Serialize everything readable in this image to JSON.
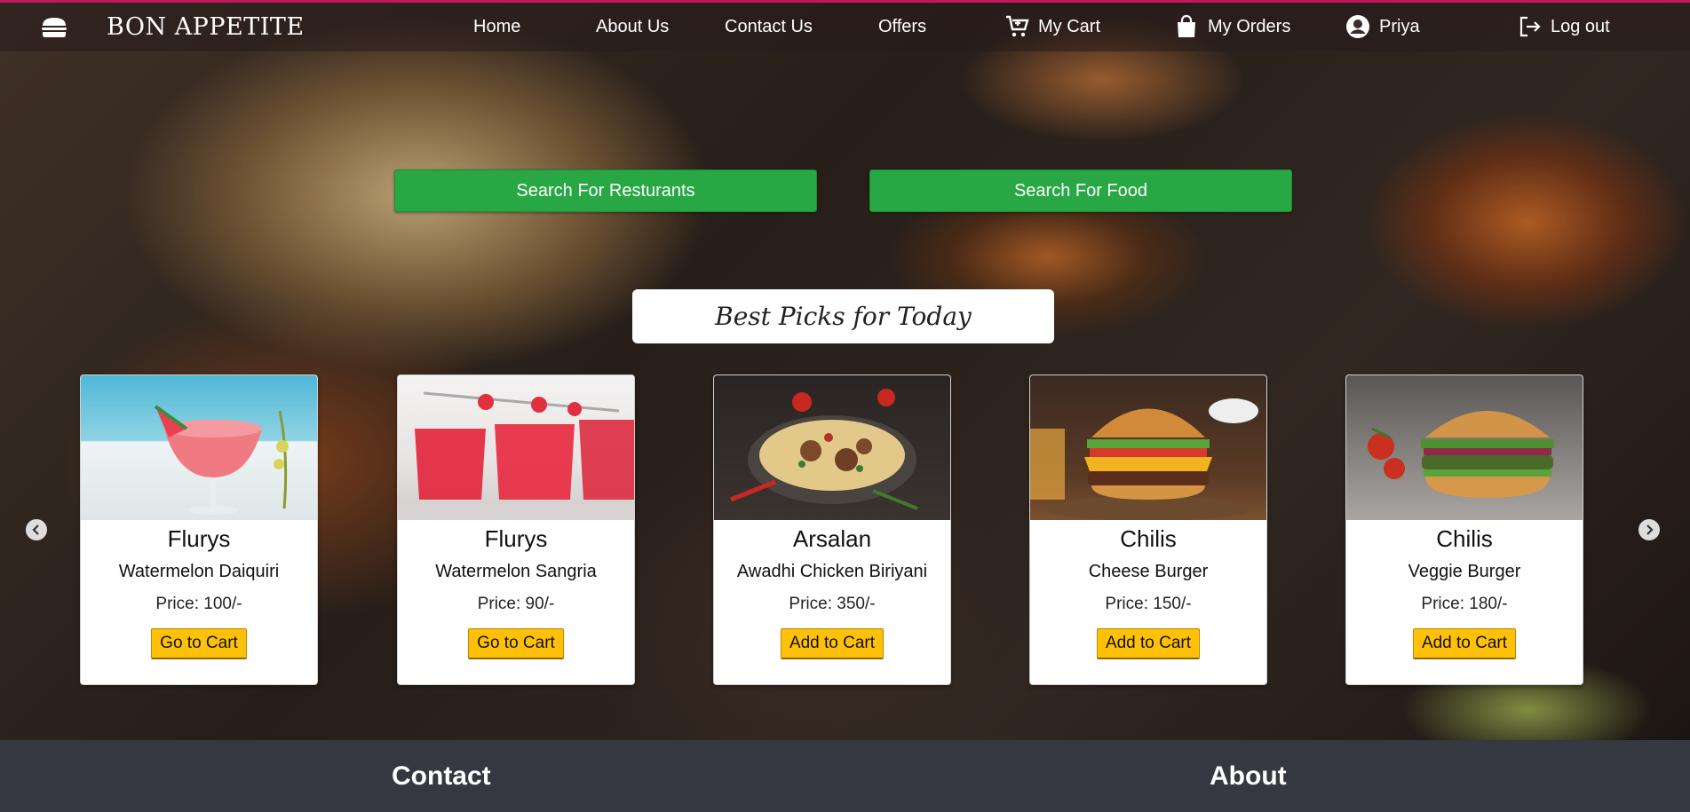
{
  "navbar": {
    "brand": "BON APPETITE",
    "brand_icon": "burger-icon",
    "links": {
      "home": "Home",
      "about": "About Us",
      "contact": "Contact Us",
      "offers": "Offers",
      "cart": "My Cart",
      "orders": "My Orders",
      "user": "Priya",
      "logout": "Log out"
    }
  },
  "search": {
    "restaurants_label": "Search For Resturants",
    "food_label": "Search For Food"
  },
  "best_picks": {
    "title": "Best Picks for Today",
    "cards": [
      {
        "restaurant": "Flurys",
        "dish": "Watermelon Daiquiri",
        "price": "Price: 100/-",
        "button": "Go to Cart",
        "image": "watermelon-daiquiri-image"
      },
      {
        "restaurant": "Flurys",
        "dish": "Watermelon Sangria",
        "price": "Price: 90/-",
        "button": "Go to Cart",
        "image": "watermelon-sangria-image"
      },
      {
        "restaurant": "Arsalan",
        "dish": "Awadhi Chicken Biriyani",
        "price": "Price: 350/-",
        "button": "Add to Cart",
        "image": "biriyani-image"
      },
      {
        "restaurant": "Chilis",
        "dish": "Cheese Burger",
        "price": "Price: 150/-",
        "button": "Add to Cart",
        "image": "cheese-burger-image"
      },
      {
        "restaurant": "Chilis",
        "dish": "Veggie Burger",
        "price": "Price: 180/-",
        "button": "Add to Cart",
        "image": "veggie-burger-image"
      }
    ]
  },
  "footer": {
    "contact_heading": "Contact",
    "about_heading": "About"
  },
  "colors": {
    "nav_accent": "#c2185b",
    "search_button": "#28a745",
    "cart_button": "#ffc107",
    "footer": "#353840"
  }
}
